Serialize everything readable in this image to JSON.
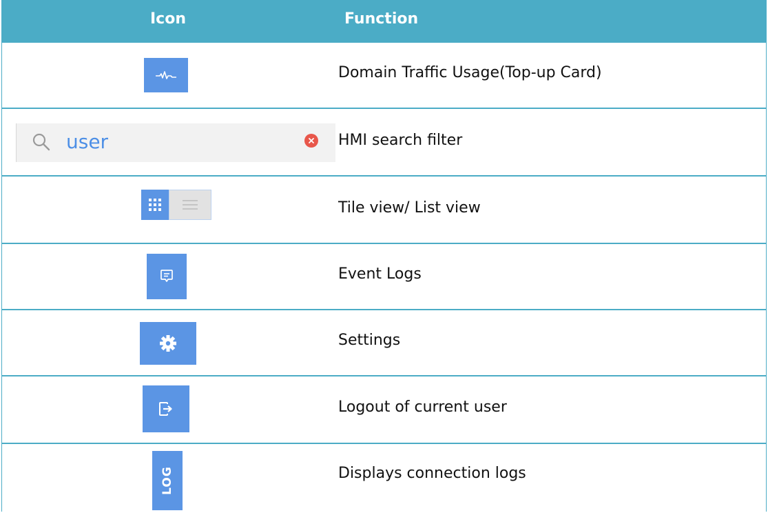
{
  "header": {
    "icon_col": "Icon",
    "function_col": "Function"
  },
  "rows": [
    {
      "icon": "traffic-pulse-icon",
      "label": "Domain Traffic Usage(Top-up Card)"
    },
    {
      "icon": "search-box-icon",
      "label": "HMI search filter",
      "search_value": "user"
    },
    {
      "icon": "tile-list-toggle-icon",
      "label": "Tile view/ List view"
    },
    {
      "icon": "event-logs-icon",
      "label": "Event Logs"
    },
    {
      "icon": "gear-icon",
      "label": "Settings"
    },
    {
      "icon": "logout-icon",
      "label": "Logout of current user"
    },
    {
      "icon": "log-tab-icon",
      "label": "Displays connection logs",
      "icon_text": "LOG"
    }
  ],
  "colors": {
    "header_bg": "#4bacc6",
    "icon_blue": "#5b95e4",
    "search_text": "#4d8fe6",
    "clear_red": "#e8574b"
  }
}
